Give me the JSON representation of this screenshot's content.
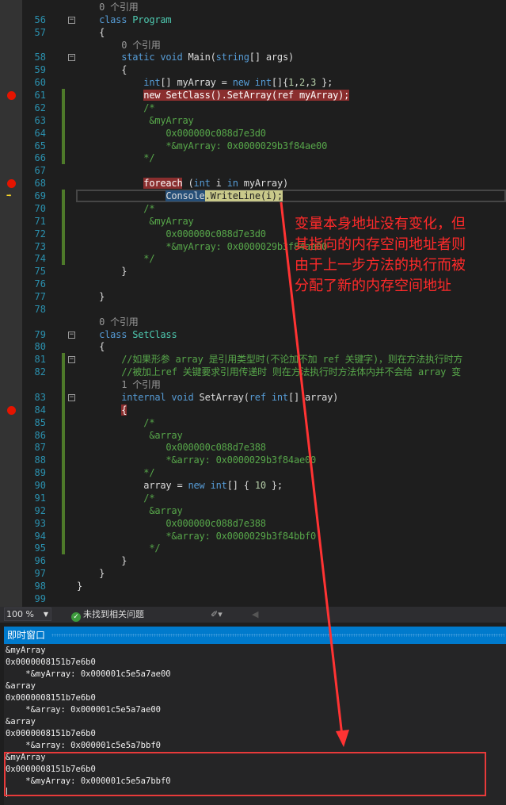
{
  "editor": {
    "rows": [
      {
        "n": "",
        "segs": [
          [
            "lens",
            "    0 个引用"
          ]
        ]
      },
      {
        "n": "56",
        "fold": true,
        "segs": [
          [
            "",
            "    "
          ],
          [
            "kw",
            "class"
          ],
          [
            "",
            " "
          ],
          [
            "ty",
            "Program"
          ]
        ]
      },
      {
        "n": "57",
        "segs": [
          [
            "",
            "    {"
          ]
        ]
      },
      {
        "n": "",
        "segs": [
          [
            "lens",
            "        0 个引用"
          ]
        ]
      },
      {
        "n": "58",
        "fold": true,
        "segs": [
          [
            "",
            "        "
          ],
          [
            "kw",
            "static void"
          ],
          [
            "",
            " Main("
          ],
          [
            "kw",
            "string"
          ],
          [
            "",
            "[] args)"
          ]
        ]
      },
      {
        "n": "59",
        "segs": [
          [
            "",
            "        {"
          ]
        ]
      },
      {
        "n": "60",
        "segs": [
          [
            "",
            "            "
          ],
          [
            "kw",
            "int"
          ],
          [
            "",
            "[] myArray = "
          ],
          [
            "kw",
            "new int"
          ],
          [
            "",
            "[]{"
          ],
          [
            "nu",
            "1"
          ],
          [
            "",
            ","
          ],
          [
            "nu",
            "2"
          ],
          [
            "",
            ","
          ],
          [
            "nu",
            "3"
          ],
          [
            "",
            " };"
          ]
        ]
      },
      {
        "n": "61",
        "bp": true,
        "chg": true,
        "segs": [
          [
            "",
            "            "
          ],
          [
            "bp",
            "new SetClass().SetArray(ref myArray);"
          ]
        ]
      },
      {
        "n": "62",
        "chg": true,
        "segs": [
          [
            "cm",
            "            /*"
          ]
        ]
      },
      {
        "n": "63",
        "chg": true,
        "segs": [
          [
            "cm",
            "             &myArray"
          ]
        ]
      },
      {
        "n": "64",
        "chg": true,
        "segs": [
          [
            "cm",
            "                0x000000c088d7e3d0"
          ]
        ]
      },
      {
        "n": "65",
        "chg": true,
        "segs": [
          [
            "cm",
            "                *&myArray: 0x0000029b3f84ae00"
          ]
        ]
      },
      {
        "n": "66",
        "chg": true,
        "segs": [
          [
            "cm",
            "            */"
          ]
        ]
      },
      {
        "n": "67",
        "segs": []
      },
      {
        "n": "68",
        "bp": true,
        "segs": [
          [
            "",
            "            "
          ],
          [
            "bp",
            "foreach"
          ],
          [
            "",
            " ("
          ],
          [
            "kw",
            "int"
          ],
          [
            "",
            " i "
          ],
          [
            "kw",
            "in"
          ],
          [
            "",
            " myArray)"
          ]
        ]
      },
      {
        "n": "69",
        "cur": true,
        "chg": true,
        "segs": [
          [
            "",
            "                "
          ],
          [
            "cb",
            "Console"
          ],
          [
            "cy",
            ".WriteLine(i);"
          ]
        ]
      },
      {
        "n": "70",
        "chg": true,
        "segs": [
          [
            "cm",
            "            /*"
          ]
        ]
      },
      {
        "n": "71",
        "chg": true,
        "segs": [
          [
            "cm",
            "             &myArray"
          ]
        ]
      },
      {
        "n": "72",
        "chg": true,
        "segs": [
          [
            "cm",
            "                0x000000c088d7e3d0"
          ]
        ]
      },
      {
        "n": "73",
        "chg": true,
        "segs": [
          [
            "cm",
            "                *&myArray: 0x0000029b3f84ae00"
          ]
        ]
      },
      {
        "n": "74",
        "chg": true,
        "segs": [
          [
            "cm",
            "            */"
          ]
        ]
      },
      {
        "n": "75",
        "segs": [
          [
            "",
            "        }"
          ]
        ]
      },
      {
        "n": "76",
        "segs": []
      },
      {
        "n": "77",
        "segs": [
          [
            "",
            "    }"
          ]
        ]
      },
      {
        "n": "78",
        "segs": []
      },
      {
        "n": "",
        "segs": [
          [
            "lens",
            "    0 个引用"
          ]
        ]
      },
      {
        "n": "79",
        "fold": true,
        "segs": [
          [
            "",
            "    "
          ],
          [
            "kw",
            "class"
          ],
          [
            "",
            " "
          ],
          [
            "ty",
            "SetClass"
          ]
        ]
      },
      {
        "n": "80",
        "segs": [
          [
            "",
            "    {"
          ]
        ]
      },
      {
        "n": "81",
        "fold": true,
        "chg": true,
        "segs": [
          [
            "cm",
            "        //如果形参 array 是引用类型时(不论加不加 ref 关键字)，则在方法执行时方"
          ]
        ]
      },
      {
        "n": "82",
        "chg": true,
        "segs": [
          [
            "cm",
            "        //被加上ref 关键要求引用传递时 则在方法执行时方法体内并不会给 array 变"
          ]
        ]
      },
      {
        "n": "",
        "chg": true,
        "segs": [
          [
            "lens",
            "        1 个引用"
          ]
        ]
      },
      {
        "n": "83",
        "fold": true,
        "chg": true,
        "segs": [
          [
            "",
            "        "
          ],
          [
            "kw",
            "internal void"
          ],
          [
            "",
            " SetArray("
          ],
          [
            "kw",
            "ref int"
          ],
          [
            "",
            "[] array)"
          ]
        ]
      },
      {
        "n": "84",
        "bp": true,
        "chg": true,
        "segs": [
          [
            "",
            "        "
          ],
          [
            "bp",
            "{"
          ]
        ]
      },
      {
        "n": "85",
        "chg": true,
        "segs": [
          [
            "cm",
            "            /*"
          ]
        ]
      },
      {
        "n": "86",
        "chg": true,
        "segs": [
          [
            "cm",
            "             &array"
          ]
        ]
      },
      {
        "n": "87",
        "chg": true,
        "segs": [
          [
            "cm",
            "                0x000000c088d7e388"
          ]
        ]
      },
      {
        "n": "88",
        "chg": true,
        "segs": [
          [
            "cm",
            "                *&array: 0x0000029b3f84ae00"
          ]
        ]
      },
      {
        "n": "89",
        "chg": true,
        "segs": [
          [
            "cm",
            "            */"
          ]
        ]
      },
      {
        "n": "90",
        "chg": true,
        "segs": [
          [
            "",
            "            array = "
          ],
          [
            "kw",
            "new int"
          ],
          [
            "",
            "[] { "
          ],
          [
            "nu",
            "10"
          ],
          [
            "",
            " };"
          ]
        ]
      },
      {
        "n": "91",
        "chg": true,
        "segs": [
          [
            "cm",
            "            /*"
          ]
        ]
      },
      {
        "n": "92",
        "chg": true,
        "segs": [
          [
            "cm",
            "             &array"
          ]
        ]
      },
      {
        "n": "93",
        "chg": true,
        "segs": [
          [
            "cm",
            "                0x000000c088d7e388"
          ]
        ]
      },
      {
        "n": "94",
        "chg": true,
        "segs": [
          [
            "cm",
            "                *&array: 0x0000029b3f84bbf0"
          ]
        ]
      },
      {
        "n": "95",
        "chg": true,
        "segs": [
          [
            "cm",
            "             */"
          ]
        ]
      },
      {
        "n": "96",
        "segs": [
          [
            "",
            "        }"
          ]
        ]
      },
      {
        "n": "97",
        "segs": [
          [
            "",
            "    }"
          ]
        ]
      },
      {
        "n": "98",
        "segs": [
          [
            "",
            "}"
          ]
        ]
      },
      {
        "n": "99",
        "segs": []
      }
    ]
  },
  "status": {
    "zoom": "100 %",
    "issues": "未找到相关问题"
  },
  "immediate": {
    "title": "即时窗口",
    "lines": [
      "&myArray",
      "0x0000008151b7e6b0",
      "    *&myArray: 0x000001c5e5a7ae00",
      "&array",
      "0x0000008151b7e6b0",
      "    *&array: 0x000001c5e5a7ae00",
      "&array",
      "0x0000008151b7e6b0",
      "    *&array: 0x000001c5e5a7bbf0",
      "&myArray",
      "0x0000008151b7e6b0",
      "    *&myArray: 0x000001c5e5a7bbf0"
    ]
  },
  "annotation": {
    "text": "变量本身地址没有变化，但\n其指向的内存空间地址者则\n由于上一步方法的执行而被\n分配了新的内存空间地址",
    "color": "#ff2a2a"
  }
}
